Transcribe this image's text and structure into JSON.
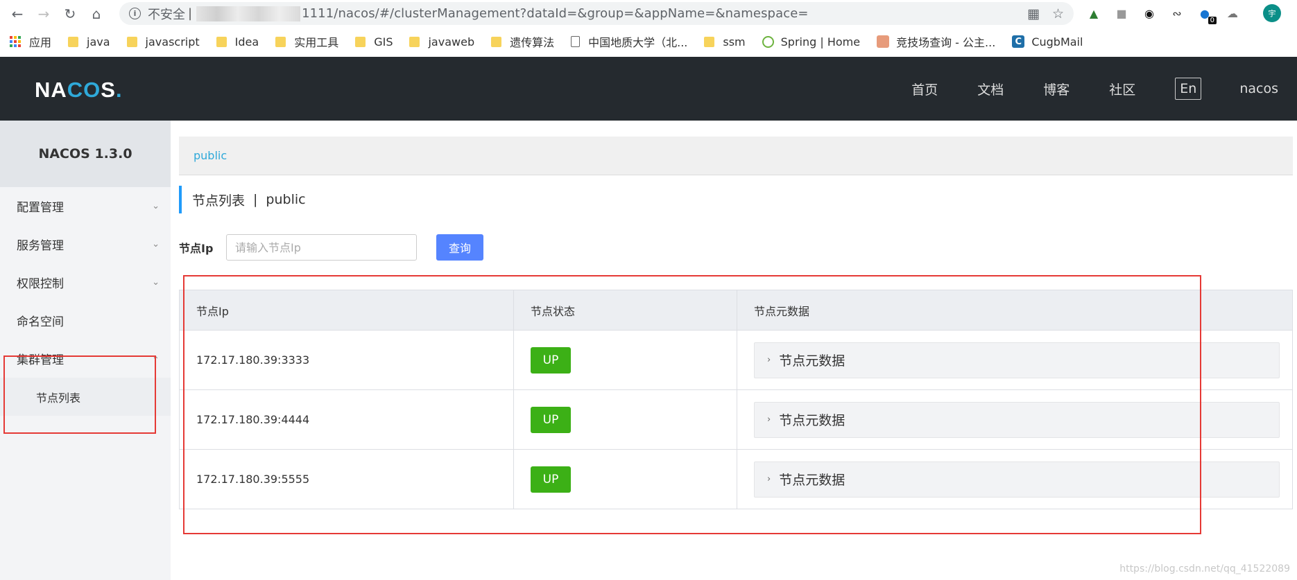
{
  "browser": {
    "insecure_label": "不安全",
    "url_suffix": "1111/nacos/#/clusterManagement?dataId=&group=&appName=&namespace=",
    "avatar_text": "宇",
    "ext_badge": "0"
  },
  "bookmarks": [
    {
      "label": "应用",
      "kind": "apps"
    },
    {
      "label": "java",
      "kind": "folder"
    },
    {
      "label": "javascript",
      "kind": "folder"
    },
    {
      "label": "Idea",
      "kind": "folder"
    },
    {
      "label": "实用工具",
      "kind": "folder"
    },
    {
      "label": "GIS",
      "kind": "folder"
    },
    {
      "label": "javaweb",
      "kind": "folder"
    },
    {
      "label": "遗传算法",
      "kind": "folder"
    },
    {
      "label": "中国地质大学（北...",
      "kind": "page"
    },
    {
      "label": "ssm",
      "kind": "folder"
    },
    {
      "label": "Spring | Home",
      "kind": "spring"
    },
    {
      "label": "竞技场查询 - 公主...",
      "kind": "anime"
    },
    {
      "label": "CugbMail",
      "kind": "c"
    }
  ],
  "header": {
    "logo": {
      "na": "NA",
      "co": "CO",
      "s": "S",
      "dot": "."
    },
    "nav": [
      "首页",
      "文档",
      "博客",
      "社区"
    ],
    "lang": "En",
    "user": "nacos"
  },
  "sidebar": {
    "title": "NACOS 1.3.0",
    "items": [
      {
        "label": "配置管理"
      },
      {
        "label": "服务管理"
      },
      {
        "label": "权限控制"
      },
      {
        "label": "命名空间"
      },
      {
        "label": "集群管理"
      }
    ],
    "sub_item": "节点列表"
  },
  "main": {
    "breadcrumb": "public",
    "title": "节点列表",
    "title_sep": "|",
    "namespace": "public",
    "filter_label": "节点Ip",
    "filter_placeholder": "请输入节点Ip",
    "query_label": "查询",
    "table": {
      "headers": [
        "节点Ip",
        "节点状态",
        "节点元数据"
      ],
      "rows": [
        {
          "ip": "172.17.180.39:3333",
          "status": "UP",
          "meta": "节点元数据"
        },
        {
          "ip": "172.17.180.39:4444",
          "status": "UP",
          "meta": "节点元数据"
        },
        {
          "ip": "172.17.180.39:5555",
          "status": "UP",
          "meta": "节点元数据"
        }
      ]
    }
  },
  "watermark": "https://blog.csdn.net/qq_41522089",
  "colors": {
    "accent": "#2fa9d9",
    "header_bg": "#252a2f",
    "up_green": "#3cb016",
    "query_blue": "#5584ff",
    "annotation_red": "#e53935"
  }
}
